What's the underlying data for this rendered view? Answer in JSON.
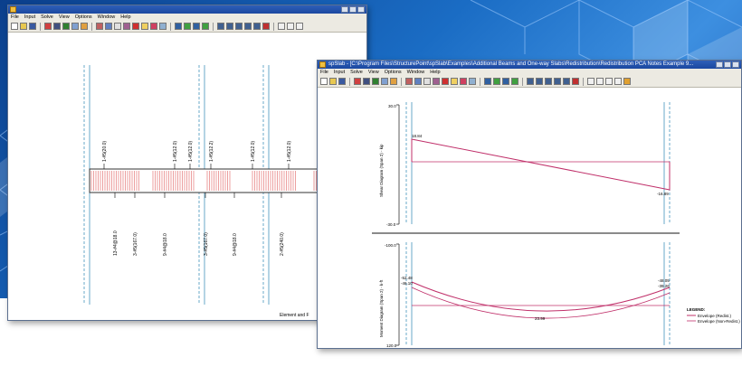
{
  "back_window": {
    "title": "",
    "menu": [
      "File",
      "Input",
      "Solve",
      "View",
      "Options",
      "Window",
      "Help"
    ],
    "rebar_top": [
      "1-#5(20.0)",
      "1-#5(12.0)",
      "1-#5(12.0)",
      "1-#5(12.2)",
      "1-#5(12.0)",
      "1-#5(12.0)"
    ],
    "rebar_bottom": [
      "13-#4@18.0",
      "3-#5(167.0)",
      "9-#4@18.0",
      "3-#5(167.0)",
      "9-#4@18.0",
      "2-#5(240.0)"
    ],
    "corner_text": "Element and F"
  },
  "front_window": {
    "title": "spSlab - [C:\\Program Files\\StructurePoint\\spSlab\\Examples\\Additional Beams and One-way Slabs\\Redistribution\\Redistribution PCA Notes Example 9...",
    "menu": [
      "File",
      "Input",
      "Solve",
      "View",
      "Options",
      "Window",
      "Help"
    ],
    "shear_chart": {
      "ylabel": "Shear Diagram (Span 2) - kip",
      "ytick_top": "30.0",
      "ytick_bottom": "-30.0",
      "left_value": "18.84",
      "right_value": "-16.89"
    },
    "moment_chart": {
      "ylabel": "Moment Diagram (Span 2) - k-ft",
      "ytick_top": "-100.0",
      "ytick_bottom": "120.0",
      "left_value_1": "-52.48",
      "left_value_2": "-46.10",
      "right_value_1": "-48.05",
      "right_value_2": "-39.26",
      "mid_value": "23.99",
      "legend_title": "LEGEND:",
      "legend_items": [
        "Envelope (Redist.)",
        "Envelope (Non-Redist.)"
      ]
    }
  },
  "colors": {
    "background_blue": "#1a6cc4",
    "title_blue": "#1b48a0",
    "diagram_line": "#c0306a",
    "column_line": "#6aa8c8",
    "rebar_hatch": "#e06060"
  }
}
